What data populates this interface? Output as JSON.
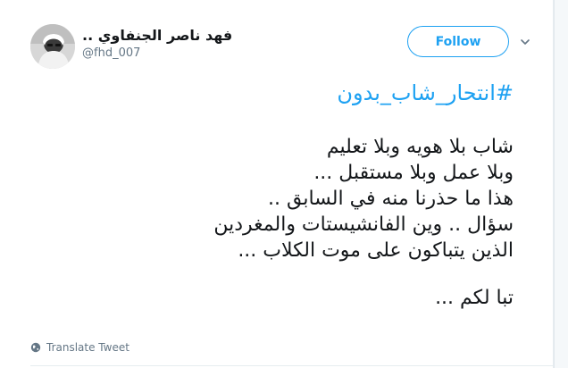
{
  "tweet": {
    "display_name": "فهد ناصر الجنفاوي ..",
    "handle": "@fhd_007",
    "follow_label": "Follow",
    "hashtag": "#انتحار_شاب_بدون",
    "lines": [
      "شاب بلا هويه وبلا تعليم",
      "وبلا عمل وبلا مستقبل ...",
      "هذا ما حذرنا منه في السابق ..",
      "سؤال .. وين الفانشيستات والمغردين",
      "الذين يتباكون على موت الكلاب ...",
      "تبا لكم ..."
    ],
    "translate_label": "Translate Tweet"
  },
  "icons": {
    "caret": "chevron-down-icon",
    "globe": "globe-icon"
  },
  "colors": {
    "accent": "#1da1f2",
    "text": "#14171a",
    "muted": "#657786"
  }
}
